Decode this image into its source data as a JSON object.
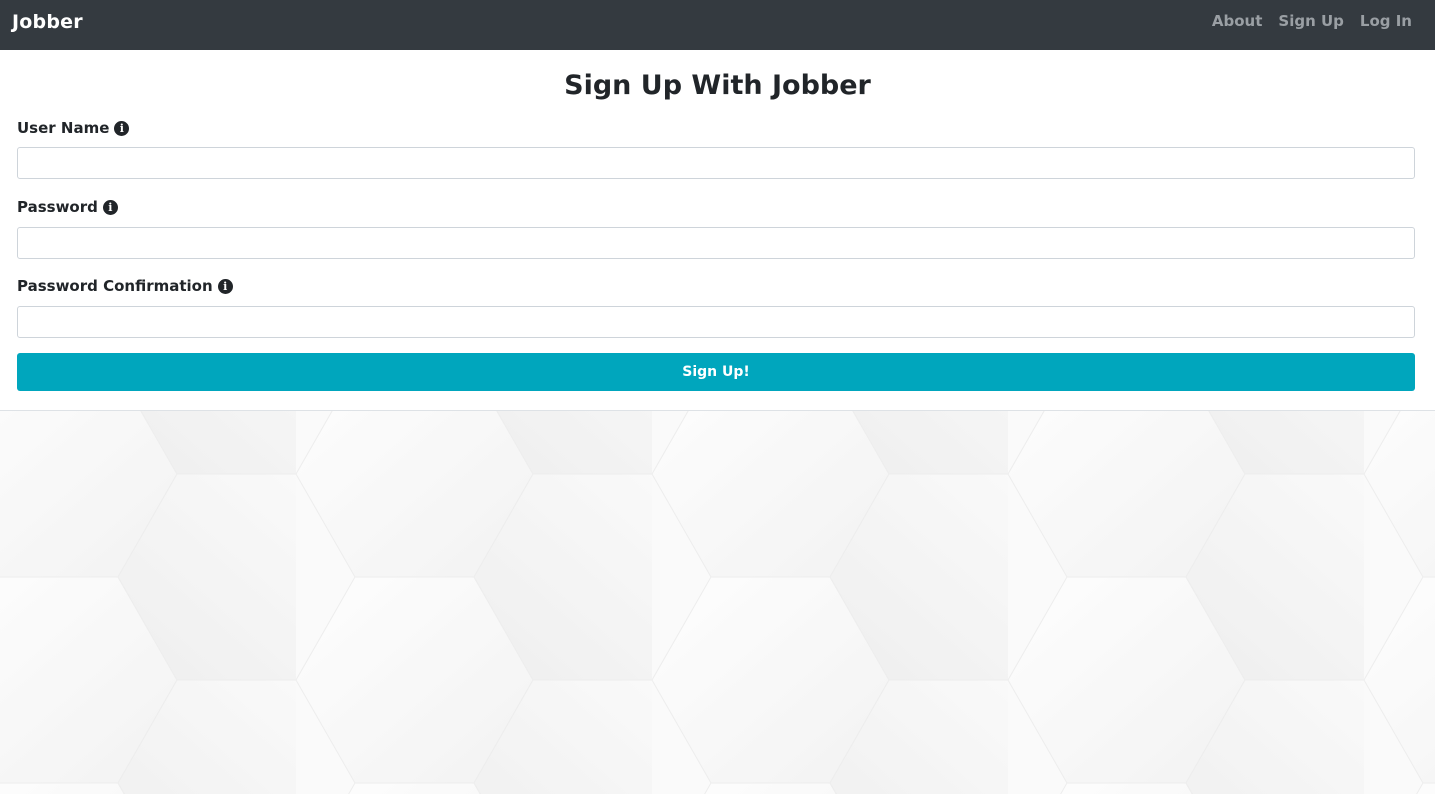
{
  "navbar": {
    "brand": "Jobber",
    "links": [
      {
        "label": "About"
      },
      {
        "label": "Sign Up"
      },
      {
        "label": "Log In"
      }
    ]
  },
  "form": {
    "title": "Sign Up With Jobber",
    "fields": [
      {
        "label": "User Name",
        "value": "",
        "icon": "info-circle-icon"
      },
      {
        "label": "Password",
        "value": "",
        "icon": "info-circle-icon"
      },
      {
        "label": "Password Confirmation",
        "value": "",
        "icon": "info-circle-icon"
      }
    ],
    "submit_label": "Sign Up!"
  },
  "colors": {
    "navbar_bg": "#343a40",
    "nav_link": "#9a9fa4",
    "submit_bg": "#00a6bd"
  }
}
